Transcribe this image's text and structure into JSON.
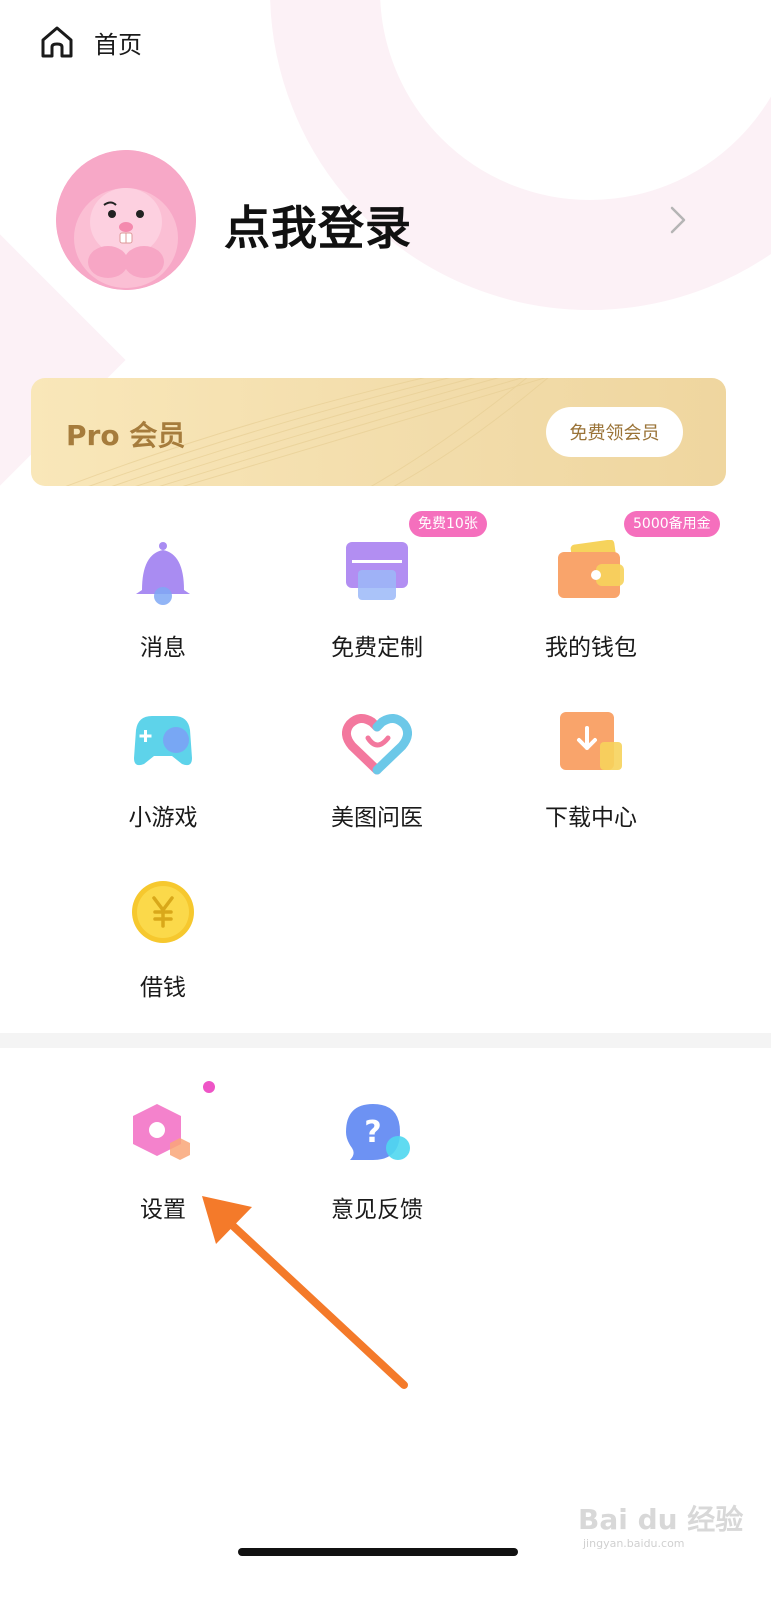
{
  "header": {
    "home_icon": "home-icon",
    "title": "首页"
  },
  "profile": {
    "avatar_icon": "beaver-avatar",
    "login_text": "点我登录",
    "chevron_icon": "chevron-right-icon"
  },
  "pro": {
    "label": "Pro 会员",
    "button": "免费领会员",
    "color": "#f5e0ae"
  },
  "grid": [
    {
      "label": "消息",
      "icon": "bell-icon",
      "badge": ""
    },
    {
      "label": "免费定制",
      "icon": "print-icon",
      "badge": "免费10张"
    },
    {
      "label": "我的钱包",
      "icon": "wallet-icon",
      "badge": "5000备用金"
    },
    {
      "label": "小游戏",
      "icon": "gamepad-icon",
      "badge": ""
    },
    {
      "label": "美图问医",
      "icon": "heart-icon",
      "badge": ""
    },
    {
      "label": "下载中心",
      "icon": "download-icon",
      "badge": ""
    },
    {
      "label": "借钱",
      "icon": "yuan-coin-icon",
      "badge": ""
    }
  ],
  "tools": [
    {
      "label": "设置",
      "icon": "settings-hexagon-icon",
      "has_dot": true
    },
    {
      "label": "意见反馈",
      "icon": "help-bubble-icon",
      "has_dot": false
    }
  ],
  "watermark": {
    "text": "Bai du 经验",
    "sub": "jingyan.baidu.com"
  },
  "colors": {
    "badge": "#f56fbd",
    "arrow": "#f47a2a",
    "dot": "#ee55c6"
  }
}
